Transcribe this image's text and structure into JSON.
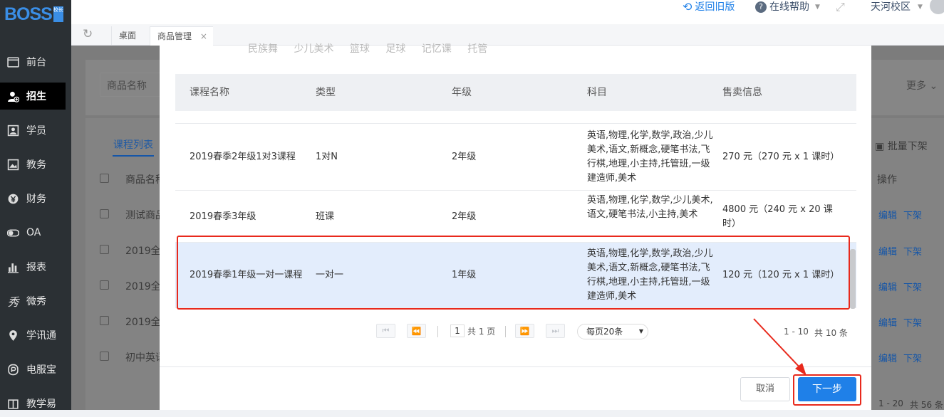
{
  "app": {
    "logo_text": "BOSS",
    "logo_badge": "校长"
  },
  "sidebar": {
    "items": [
      {
        "label": "前台",
        "icon": "monitor-icon"
      },
      {
        "label": "招生",
        "icon": "add-user-icon",
        "active": true
      },
      {
        "label": "学员",
        "icon": "id-card-icon"
      },
      {
        "label": "教务",
        "icon": "picture-icon"
      },
      {
        "label": "财务",
        "icon": "yen-icon"
      },
      {
        "label": "OA",
        "icon": "toggle-icon"
      },
      {
        "label": "报表",
        "icon": "bar-chart-icon"
      },
      {
        "label": "微秀",
        "icon": "xiu-icon"
      },
      {
        "label": "学讯通",
        "icon": "location-icon"
      },
      {
        "label": "电服宝",
        "icon": "phone-icon"
      },
      {
        "label": "教学易",
        "icon": "book-icon"
      }
    ]
  },
  "topbar": {
    "back_old": "返回旧版",
    "help": "在线帮助",
    "campus": "天河校区"
  },
  "tabs": [
    {
      "label": "桌面"
    },
    {
      "label": "商品管理",
      "active": true
    }
  ],
  "background": {
    "search_placeholder": "商品名称",
    "more": "更多",
    "list_tab": "课程列表",
    "batch_off": "批量下架",
    "col_name": "商品名称",
    "col_ops": "操作",
    "rows": [
      "测试商品",
      "2019全",
      "2019全",
      "2019全",
      "初中英语"
    ],
    "edit": "编辑",
    "off": "下架",
    "pager_info": "1 - 20",
    "total": "共 56 条"
  },
  "modal": {
    "tags": "民族舞 少儿美术 篮球 足球 记忆课 托管",
    "columns": [
      "课程名称",
      "类型",
      "年级",
      "科目",
      "售卖信息"
    ],
    "rows": [
      {
        "name": "2019春季2年级1对3课程",
        "type": "1对N",
        "grade": "2年级",
        "subjects": "英语,物理,化学,数学,政治,少儿美术,语文,新概念,硬笔书法,飞行棋,地理,小主持,托管班,一级建造师,美术",
        "sale": "270 元（270 元 x 1 课时）"
      },
      {
        "name": "2019春季3年级",
        "type": "班课",
        "grade": "2年级",
        "subjects": "英语,物理,化学,数学,少儿美术,语文,硬笔书法,小主持,美术",
        "sale": "4800 元（240 元 x 20 课时）"
      },
      {
        "name": "2019春季1年级一对一课程",
        "type": "一对一",
        "grade": "1年级",
        "subjects": "英语,物理,化学,数学,政治,少儿美术,语文,新概念,硬笔书法,飞行棋,地理,小主持,托管班,一级建造师,美术",
        "sale": "120 元（120 元 x 1 课时）",
        "selected": true
      }
    ],
    "pager": {
      "page": "1",
      "total_pages": "共 1 页",
      "page_size": "每页20条",
      "range": "1 - 10",
      "total": "共 10 条"
    },
    "cancel": "取消",
    "next": "下一步"
  },
  "colors": {
    "accent": "#1f80e8",
    "highlight_border": "#e8291c",
    "sidebar_bg": "#2b3034",
    "selected_row": "#e3edfc"
  }
}
